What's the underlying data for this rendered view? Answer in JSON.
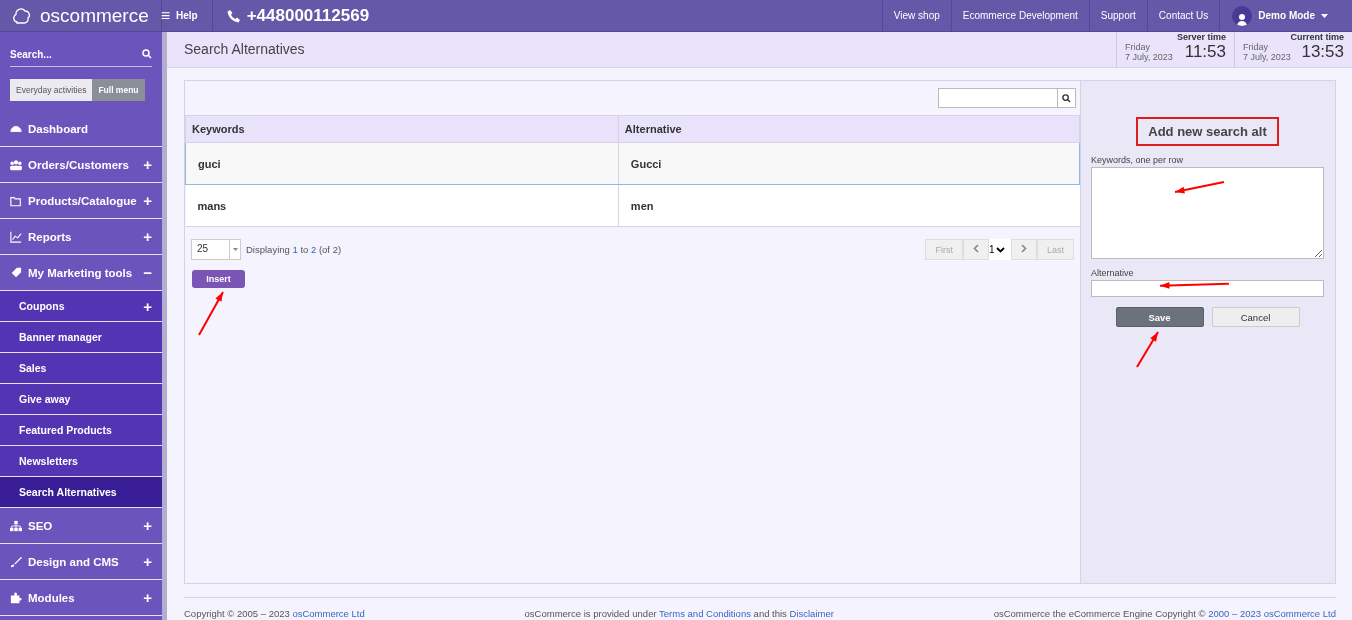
{
  "topbar": {
    "logo": "oscommerce",
    "menu_glyph": "≡",
    "help": "Help",
    "phone": "+448000112569",
    "links": [
      "View shop",
      "Ecommerce Development",
      "Support",
      "Contact Us"
    ],
    "user": "Demo Mode"
  },
  "sidebar": {
    "search": {
      "placeholder": "Search..."
    },
    "modes": [
      {
        "label": "Everyday activities",
        "selected": false
      },
      {
        "label": "Full menu",
        "selected": true
      }
    ],
    "items": [
      {
        "kind": "main",
        "label": "Dashboard",
        "selected": false
      },
      {
        "kind": "main",
        "label": "Orders/Customers",
        "toggle": "+",
        "selected": false
      },
      {
        "kind": "main",
        "label": "Products/Catalogue",
        "toggle": "+",
        "selected": false
      },
      {
        "kind": "main",
        "label": "Reports",
        "toggle": "+",
        "selected": false
      },
      {
        "kind": "main",
        "label": "My Marketing tools",
        "toggle": "−",
        "selected": false
      },
      {
        "kind": "sub",
        "label": "Coupons",
        "toggle": "+",
        "selected": false
      },
      {
        "kind": "sub",
        "label": "Banner manager",
        "selected": false
      },
      {
        "kind": "sub",
        "label": "Sales",
        "selected": false
      },
      {
        "kind": "sub",
        "label": "Give away",
        "selected": false
      },
      {
        "kind": "sub",
        "label": "Featured Products",
        "selected": false
      },
      {
        "kind": "sub",
        "label": "Newsletters",
        "selected": false
      },
      {
        "kind": "sub",
        "label": "Search Alternatives",
        "selected": true
      },
      {
        "kind": "main",
        "label": "SEO",
        "toggle": "+",
        "selected": false
      },
      {
        "kind": "main",
        "label": "Design and CMS",
        "toggle": "+",
        "selected": false
      },
      {
        "kind": "main",
        "label": "Modules",
        "toggle": "+",
        "selected": false
      }
    ]
  },
  "page": {
    "title": "Search Alternatives",
    "clocks": [
      {
        "label": "Server time",
        "day": "Friday",
        "date": "7 July, 2023",
        "time": "11:53"
      },
      {
        "label": "Current time",
        "day": "Friday",
        "date": "7 July, 2023",
        "time": "13:53"
      }
    ]
  },
  "table": {
    "columns": [
      "Keywords",
      "Alternative"
    ],
    "rows": [
      {
        "cells": [
          "guci",
          "Gucci"
        ],
        "selected": true
      },
      {
        "cells": [
          "mans",
          "men"
        ],
        "selected": false
      }
    ],
    "per_page": "25",
    "displaying": {
      "prefix": "Displaying",
      "from": "1",
      "to_word": "to",
      "to": "2",
      "total": "(of 2)"
    },
    "pager": {
      "first": "First",
      "page": "1",
      "last": "Last"
    },
    "insert": "Insert"
  },
  "form": {
    "title": "Add new search alt",
    "keywords_label": "Keywords, one per row",
    "alternative_label": "Alternative",
    "save": "Save",
    "cancel": "Cancel"
  },
  "footer": {
    "left": {
      "text": "Copyright © 2005 – 2023",
      "link": "osCommerce Ltd"
    },
    "center": {
      "text1": "osCommerce is provided under",
      "link1": "Terms and Conditions",
      "text2": "and this",
      "link2": "Disclaimer"
    },
    "right": {
      "text1": "osCommerce the eCommerce Engine Copyright ©",
      "link1": "2000 – 2023 osCommerce Ltd"
    }
  }
}
